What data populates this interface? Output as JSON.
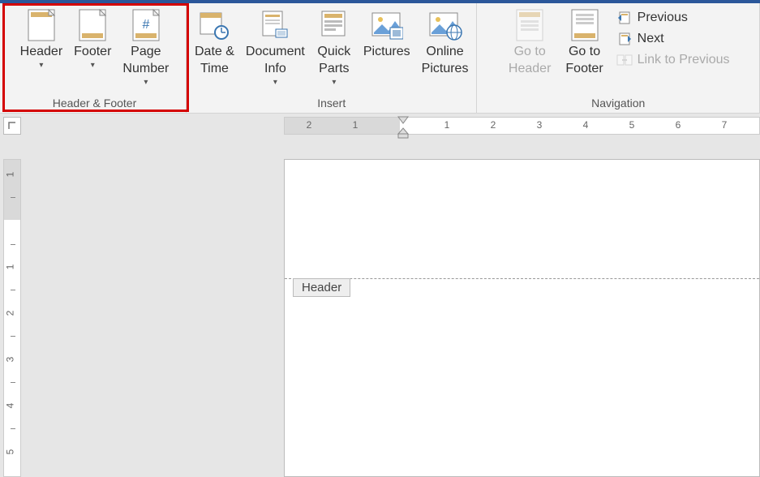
{
  "ribbon": {
    "group_hf": {
      "label": "Header & Footer",
      "header": "Header",
      "footer": "Footer",
      "page_number": "Page\nNumber"
    },
    "group_insert": {
      "label": "Insert",
      "date_time": "Date &\nTime",
      "doc_info": "Document\nInfo",
      "quick_parts": "Quick\nParts",
      "pictures": "Pictures",
      "online_pictures": "Online\nPictures"
    },
    "group_nav": {
      "label": "Navigation",
      "goto_header": "Go to\nHeader",
      "goto_footer": "Go to\nFooter",
      "previous": "Previous",
      "next": "Next",
      "link_prev": "Link to Previous"
    }
  },
  "hruler_numbers": [
    "2",
    "1",
    "1",
    "2",
    "3",
    "4",
    "5",
    "6",
    "7"
  ],
  "vruler_numbers": [
    "1",
    "1",
    "2",
    "3",
    "4",
    "5"
  ],
  "doc": {
    "header_tag": "Header"
  },
  "colors": {
    "accent": "#2b579a",
    "highlight": "#d40000",
    "page_bg": "#ffffff",
    "shade": "#d9d9d9"
  },
  "chev": "▾"
}
